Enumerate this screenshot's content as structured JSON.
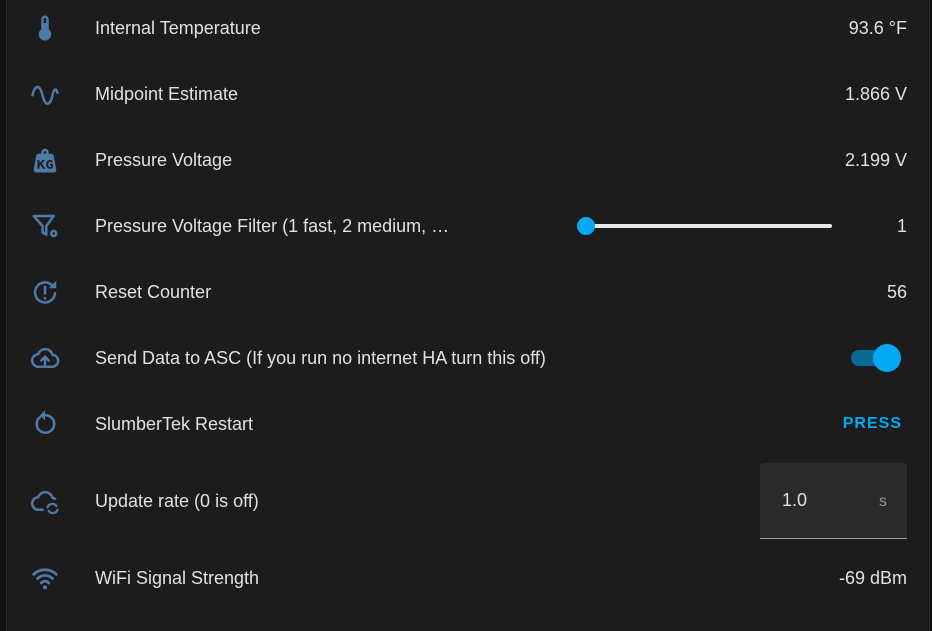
{
  "colors": {
    "icon": "#4f7aa6",
    "accent": "#03a9f4",
    "background": "#1c1c1c",
    "text": "#e1e1e1"
  },
  "entities": [
    {
      "label": "Internal Temperature",
      "value": "93.6 °F",
      "icon": "thermometer-icon"
    },
    {
      "label": "Midpoint Estimate",
      "value": "1.866 V",
      "icon": "sine-wave-icon"
    },
    {
      "label": "Pressure Voltage",
      "value": "2.199 V",
      "icon": "weight-kg-icon"
    },
    {
      "label": "Pressure Voltage Filter (1 fast, 2 medium, …",
      "value": "1",
      "icon": "filter-cog-icon",
      "slider_fraction": 0.0
    },
    {
      "label": "Reset Counter",
      "value": "56",
      "icon": "alert-circle-arrow-icon"
    },
    {
      "label": "Send Data to ASC (If you run no internet HA turn this off)",
      "icon": "cloud-upload-icon",
      "toggle_on": true
    },
    {
      "label": "SlumberTek Restart",
      "button_label": "PRESS",
      "icon": "restart-icon"
    },
    {
      "label": "Update rate (0 is off)",
      "input_value": "1.0",
      "input_unit": "s",
      "icon": "cloud-sync-icon"
    },
    {
      "label": "WiFi Signal Strength",
      "value": "-69 dBm",
      "icon": "wifi-icon"
    }
  ]
}
